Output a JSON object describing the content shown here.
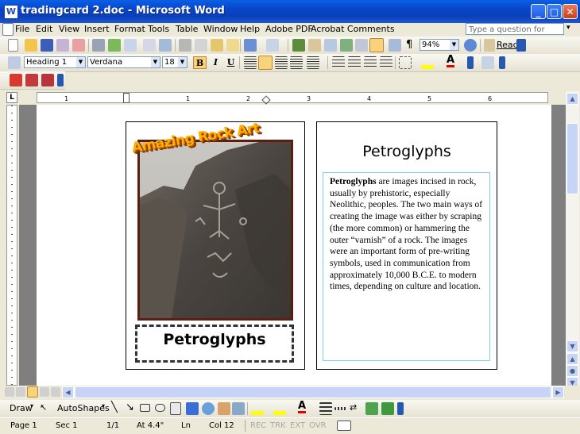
{
  "window": {
    "title": "tradingcard 2.doc - Microsoft Word",
    "app_icon": "W"
  },
  "menu": [
    "File",
    "Edit",
    "View",
    "Insert",
    "Format",
    "Tools",
    "Table",
    "Window",
    "Help",
    "Adobe PDF",
    "Acrobat Comments"
  ],
  "ask_placeholder": "Type a question for help",
  "standard": {
    "zoom": "94%",
    "read_label": "Read",
    "pilcrow": "¶"
  },
  "formatting": {
    "style": "Heading 1",
    "font": "Verdana",
    "size": "18",
    "bold": "B",
    "italic": "I",
    "underline": "U",
    "font_color_letter": "A"
  },
  "ruler": {
    "numbers": [
      "1",
      "1",
      "2",
      "3",
      "4",
      "5",
      "6"
    ],
    "tab_marker": "L"
  },
  "card": {
    "banner": "Amazing Rock Art",
    "caption": "Petroglyphs",
    "right_title": "Petroglyphs",
    "body_lead": "Petroglyphs",
    "body_rest": " are images incised in rock, usually by prehistoric, especially Neolithic, peoples. The two main ways of creating the image was either by scraping (the more common) or hammering the outer “varnish” of a rock. The images were an important form of pre-writing symbols, used in communication from approximately 10,000 B.C.E. to modern times, depending on culture and location."
  },
  "draw": {
    "draw_label": "Draw",
    "autoshapes_label": "AutoShapes"
  },
  "status": {
    "page": "Page 1",
    "sec": "Sec 1",
    "pages": "1/1",
    "at": "At 4.4\"",
    "ln": "Ln",
    "col": "Col 12",
    "rec": "REC",
    "trk": "TRK",
    "ext": "EXT",
    "ovr": "OVR"
  },
  "colors": {
    "title_blue": "#0a4fd8",
    "banner_orange": "#ffb000",
    "textbox_border": "#7fd3e0"
  }
}
